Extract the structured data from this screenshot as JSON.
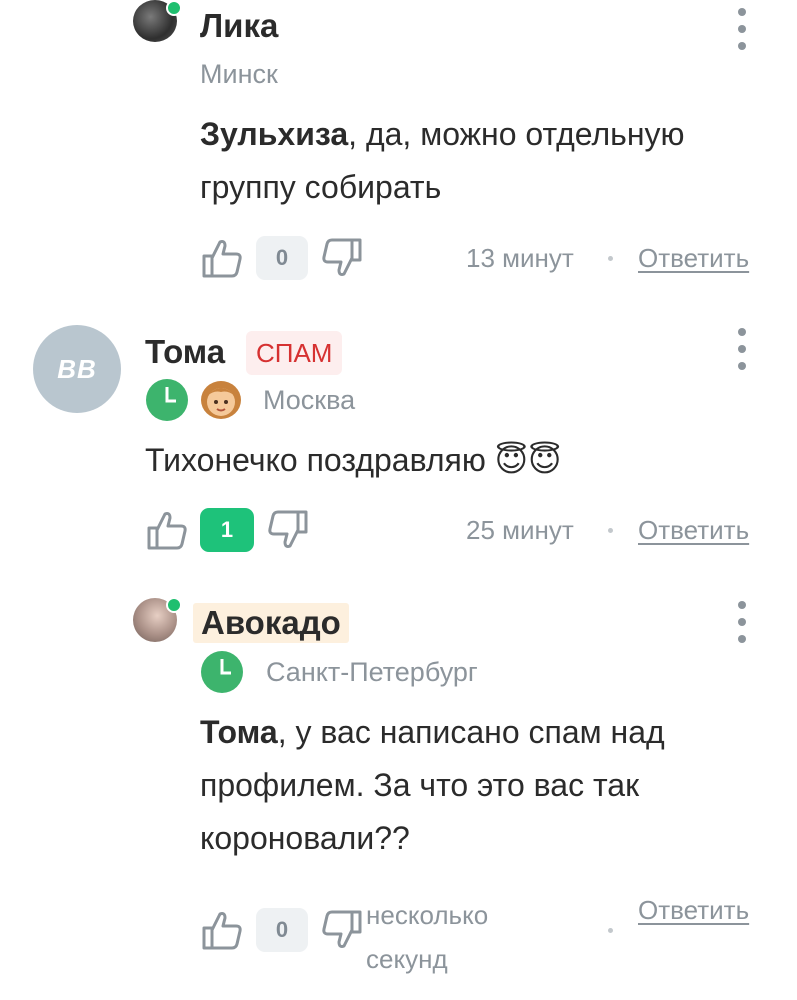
{
  "comments": [
    {
      "author": "Лика",
      "city": "Минск",
      "mention": "Зульхиза",
      "text": ", да, можно отдельную группу собирать",
      "likes": "0",
      "time": "13 минут",
      "reply_label": "Ответить"
    },
    {
      "author": "Тома",
      "badge": "СПАМ",
      "avatar_initials": "BB",
      "city": "Москва",
      "text": "Тихонечко поздравляю 😇😇",
      "likes": "1",
      "time": "25 минут",
      "reply_label": "Ответить"
    },
    {
      "author": "Авокадо",
      "city": "Санкт-Петербург",
      "mention": "Тома",
      "text": ", у вас написано спам над профилем. За что это вас так короновали??",
      "likes": "0",
      "time_line1": "несколько",
      "time_line2": "секунд",
      "reply_label": "Ответить"
    }
  ],
  "colors": {
    "online": "#1fbf6f",
    "spam_bg": "#fdeeee",
    "spam_text": "#d63131",
    "positive_count": "#1ec27a",
    "muted": "#8c949b"
  },
  "icons": [
    "thumb-up-icon",
    "thumb-down-icon",
    "kebab-menu-icon",
    "clock-icon",
    "girl-emoji-icon"
  ]
}
